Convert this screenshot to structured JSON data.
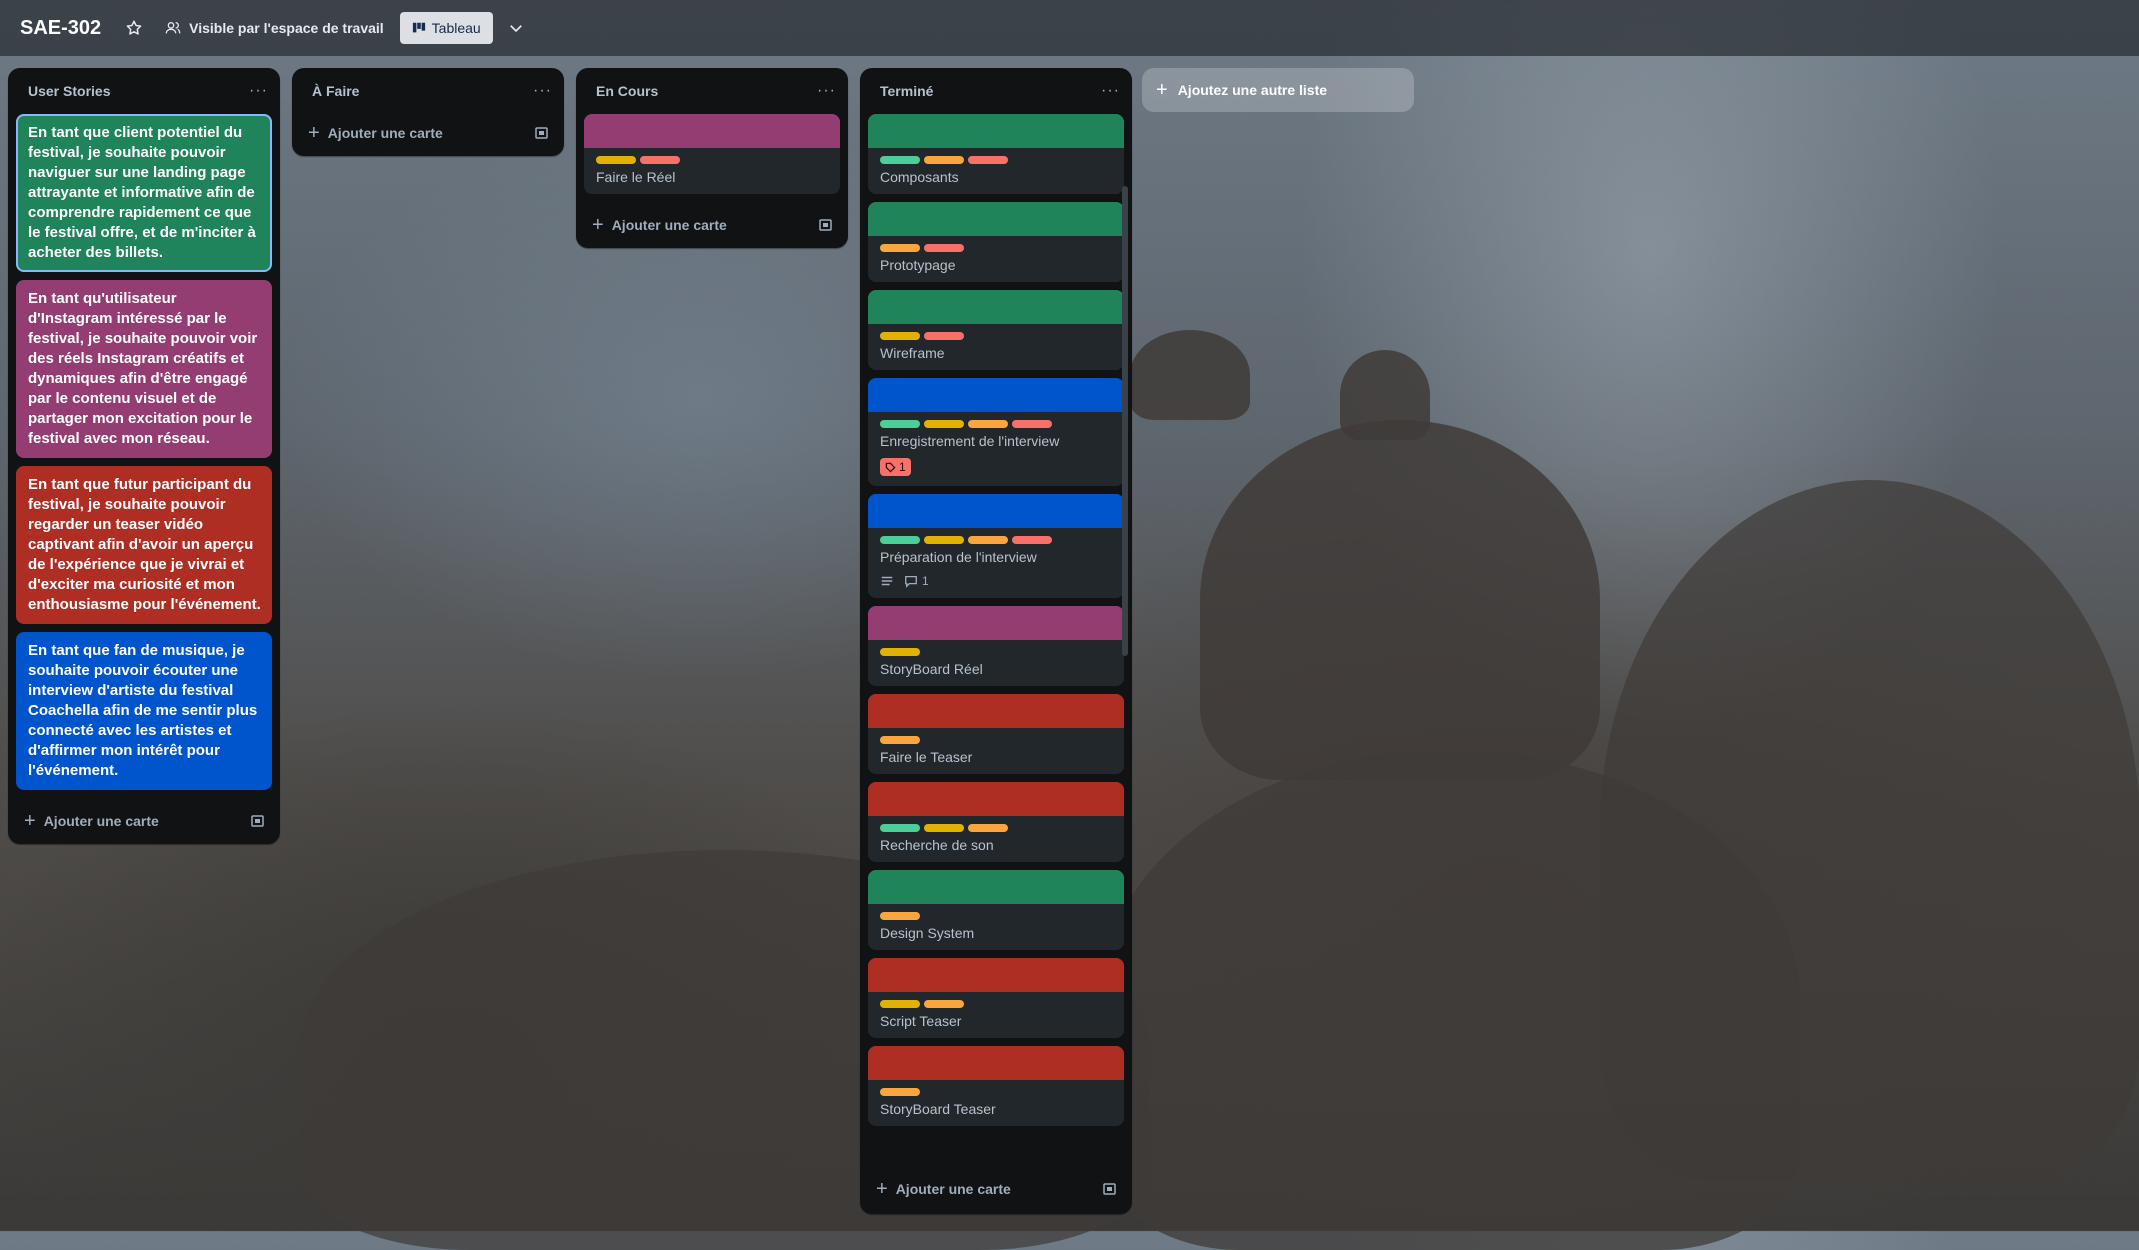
{
  "header": {
    "board_title": "SAE-302",
    "visibility": "Visible par l'espace de travail",
    "view": "Tableau"
  },
  "colors": {
    "green": "#1f845a",
    "purple": "#943d73",
    "red": "#ae2e24",
    "blue": "#0055cc",
    "label_green": "#4bce97",
    "label_yellow": "#e2b203",
    "label_orange": "#faa53d",
    "label_red": "#f87168"
  },
  "lists": [
    {
      "title": "User Stories",
      "stories": [
        {
          "text": "En tant que client potentiel du festival, je souhaite pouvoir naviguer sur une landing page attrayante et informative afin de comprendre rapidement ce que le festival offre, et de m'inciter à acheter des billets.",
          "color": "green"
        },
        {
          "text": "En tant qu'utilisateur d'Instagram intéressé par le festival, je souhaite pouvoir voir des réels Instagram créatifs et dynamiques afin d'être engagé par le contenu visuel et de partager mon excitation pour le festival avec mon réseau.",
          "color": "purple"
        },
        {
          "text": "En tant que futur participant du festival, je souhaite pouvoir regarder un teaser vidéo captivant afin d'avoir un aperçu de l'expérience que je vivrai et d'exciter ma curiosité et mon enthousiasme pour l'événement.",
          "color": "red"
        },
        {
          "text": "En tant que fan de musique, je souhaite pouvoir écouter une interview d'artiste du festival Coachella afin de me sentir plus connecté avec les artistes et d'affirmer mon intérêt pour l'événement.",
          "color": "blue"
        }
      ],
      "add_card": "Ajouter une carte"
    },
    {
      "title": "À Faire",
      "add_card": "Ajouter une carte"
    },
    {
      "title": "En Cours",
      "cards": [
        {
          "title": "Faire le Réel",
          "cover": "purple",
          "labels": [
            "yellow",
            "red"
          ]
        }
      ],
      "add_card": "Ajouter une carte"
    },
    {
      "title": "Terminé",
      "cards": [
        {
          "title": "Composants",
          "cover": "green",
          "labels": [
            "green",
            "orange",
            "red"
          ]
        },
        {
          "title": "Prototypage",
          "cover": "green",
          "labels": [
            "orange",
            "red"
          ]
        },
        {
          "title": "Wireframe",
          "cover": "green",
          "labels": [
            "yellow",
            "red"
          ]
        },
        {
          "title": "Enregistrement de l'interview",
          "cover": "blue",
          "labels": [
            "green",
            "yellow",
            "orange",
            "red"
          ],
          "badge_count": "1"
        },
        {
          "title": "Préparation de l'interview",
          "cover": "blue",
          "labels": [
            "green",
            "yellow",
            "orange",
            "red"
          ],
          "comments": "1"
        },
        {
          "title": "StoryBoard Réel",
          "cover": "purple",
          "labels": [
            "yellow"
          ]
        },
        {
          "title": "Faire le Teaser",
          "cover": "red",
          "labels": [
            "orange"
          ]
        },
        {
          "title": "Recherche de son",
          "cover": "red",
          "labels": [
            "green",
            "yellow",
            "orange"
          ]
        },
        {
          "title": "Design System",
          "cover": "green",
          "labels": [
            "orange"
          ]
        },
        {
          "title": "Script Teaser",
          "cover": "red",
          "labels": [
            "yellow",
            "orange"
          ]
        },
        {
          "title": "StoryBoard Teaser",
          "cover": "red",
          "labels": [
            "orange"
          ]
        }
      ],
      "add_card": "Ajouter une carte"
    }
  ],
  "add_list": "Ajoutez une autre liste"
}
